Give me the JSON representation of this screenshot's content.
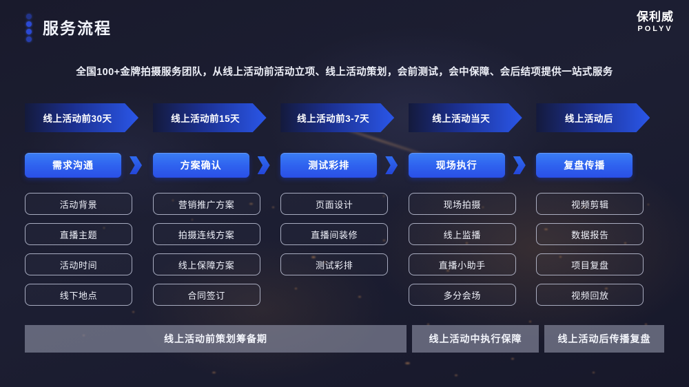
{
  "header": {
    "title": "服务流程",
    "brand_cn": "保利威",
    "brand_en": "POLYV",
    "dots_color": "#2b49d6"
  },
  "subtitle": "全国100+金牌拍摄服务团队，从线上活动前活动立项、线上活动策划，会前测试，会中保障、会后结项提供一站式服务",
  "theme": {
    "background": "#1a1b2e",
    "accent_blue": "#2a56e8",
    "pill_blue": "#3b7ef5",
    "item_border": "#ced4e8",
    "summary_grey": "#9296aa"
  },
  "columns": [
    {
      "banner": "线上活动前30天",
      "stage": "需求沟通",
      "items": [
        "活动背景",
        "直播主题",
        "活动时间",
        "线下地点"
      ]
    },
    {
      "banner": "线上活动前15天",
      "stage": "方案确认",
      "items": [
        "营销推广方案",
        "拍摄连线方案",
        "线上保障方案",
        "合同签订"
      ]
    },
    {
      "banner": "线上活动前3-7天",
      "stage": "测试彩排",
      "items": [
        "页面设计",
        "直播间装修",
        "测试彩排"
      ]
    },
    {
      "banner": "线上活动当天",
      "stage": "现场执行",
      "items": [
        "现场拍摄",
        "线上监播",
        "直播小助手",
        "多分会场"
      ]
    },
    {
      "banner": "线上活动后",
      "stage": "复盘传播",
      "items": [
        "视频剪辑",
        "数据报告",
        "项目复盘",
        "视频回放"
      ]
    }
  ],
  "summary": [
    "线上活动前策划筹备期",
    "线上活动中执行保障",
    "线上活动后传播复盘"
  ]
}
